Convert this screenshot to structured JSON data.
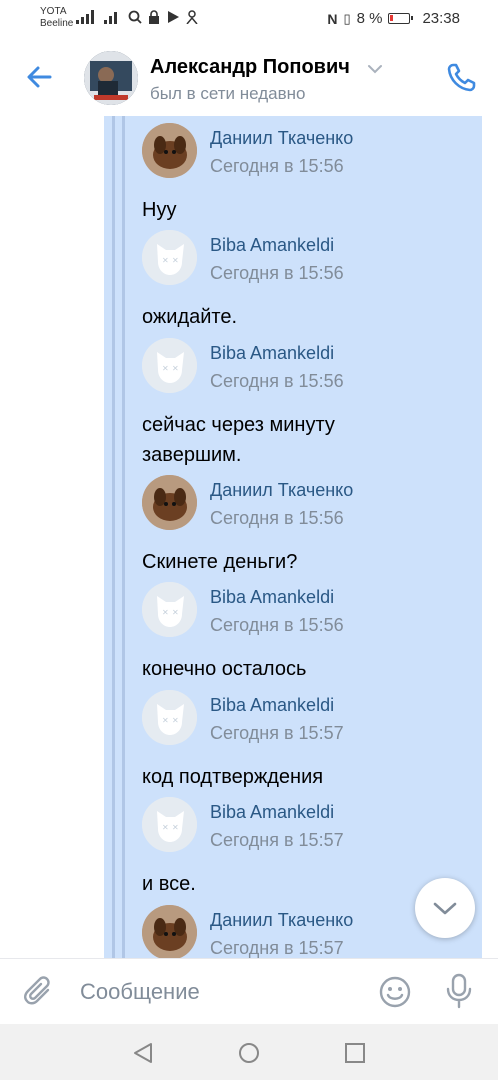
{
  "status_bar": {
    "carrier_1": "YOTA",
    "carrier_2": "Beeline",
    "battery_percent": "8 %",
    "time": "23:38",
    "battery_color": "#e53935"
  },
  "header": {
    "name": "Александр Попович",
    "status": "был в сети недавно",
    "accent": "#3f8ae0"
  },
  "messages": [
    {
      "author": "Даниил Ткаченко",
      "time": "Сегодня в 15:56",
      "text": "Нуу",
      "avatar": "dog-photo"
    },
    {
      "author": "Biba Amankeldi",
      "time": "Сегодня в 15:56",
      "text": "ожидайте.",
      "avatar": "vk-default-dog-icon"
    },
    {
      "author": "Biba Amankeldi",
      "time": "Сегодня в 15:56",
      "text": "сейчас через минуту завершим.",
      "avatar": "vk-default-dog-icon"
    },
    {
      "author": "Даниил Ткаченко",
      "time": "Сегодня в 15:56",
      "text": "Скинете деньги?",
      "avatar": "dog-photo"
    },
    {
      "author": "Biba Amankeldi",
      "time": "Сегодня в 15:56",
      "text": "конечно осталось",
      "avatar": "vk-default-dog-icon"
    },
    {
      "author": "Biba Amankeldi",
      "time": "Сегодня в 15:57",
      "text": "код подтверждения",
      "avatar": "vk-default-dog-icon"
    },
    {
      "author": "Biba Amankeldi",
      "time": "Сегодня в 15:57",
      "text": "и все.",
      "avatar": "vk-default-dog-icon"
    },
    {
      "author": "Даниил Ткаченко",
      "time": "Сегодня в 15:57",
      "text": "",
      "avatar": "dog-photo"
    }
  ],
  "composer": {
    "placeholder": "Сообщение"
  },
  "colors": {
    "forward_bg": "#cde1fb",
    "author": "#2a5885",
    "meta": "#818c99"
  }
}
